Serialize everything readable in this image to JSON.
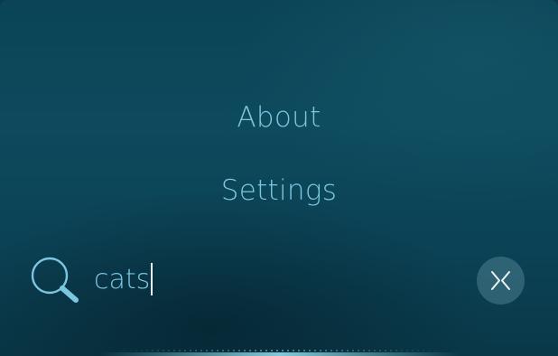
{
  "menu": {
    "items": [
      {
        "label": "About"
      },
      {
        "label": "Settings"
      }
    ]
  },
  "search": {
    "icon": "search-icon",
    "value": "cats"
  },
  "close_button": {
    "icon": "close-icon"
  },
  "colors": {
    "background": "#0c4557",
    "text": "#7cc6e0",
    "caret": "#e6f6fb",
    "button_bg": "#5b8a99"
  }
}
